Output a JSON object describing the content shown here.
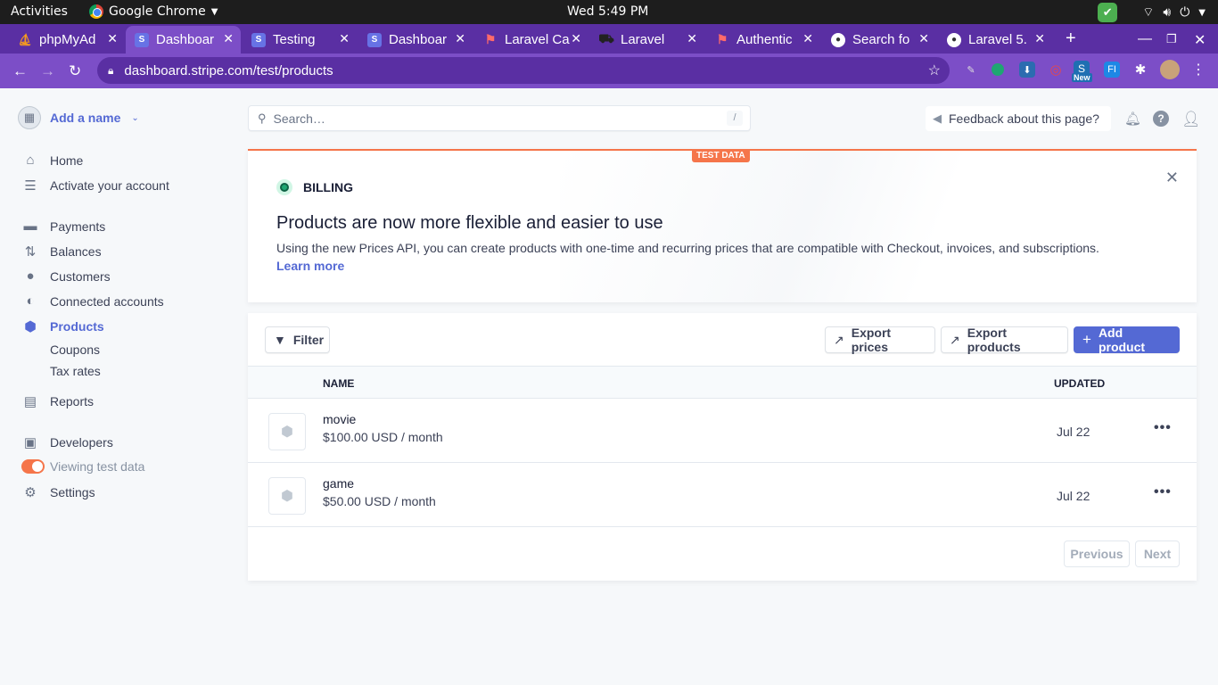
{
  "os": {
    "activities": "Activities",
    "app_name": "Google Chrome",
    "clock": "Wed  5:49 PM"
  },
  "browser": {
    "tabs": [
      {
        "label": "phpMyAd",
        "favicon": "phpmyadmin-icon"
      },
      {
        "label": "Dashboar",
        "favicon": "stripe-icon",
        "active": true
      },
      {
        "label": "Testing",
        "favicon": "stripe-icon"
      },
      {
        "label": "Dashboar",
        "favicon": "stripe-icon"
      },
      {
        "label": "Laravel Ca",
        "favicon": "laravel-icon"
      },
      {
        "label": "Laravel",
        "favicon": "truck-icon"
      },
      {
        "label": "Authentic",
        "favicon": "laravel-icon"
      },
      {
        "label": "Search fo",
        "favicon": "github-icon"
      },
      {
        "label": "Laravel 5.",
        "favicon": "github-icon"
      }
    ],
    "url": "dashboard.stripe.com/test/products",
    "ext_new_badge": "New",
    "ext_fi_label": "FI"
  },
  "sidebar": {
    "account_name": "Add a name",
    "items": [
      {
        "label": "Home",
        "icon": "home-icon"
      },
      {
        "label": "Activate your account",
        "icon": "list-edit-icon"
      },
      {
        "label": "Payments",
        "icon": "wallet-icon"
      },
      {
        "label": "Balances",
        "icon": "arrows-icon"
      },
      {
        "label": "Customers",
        "icon": "user-circle-icon"
      },
      {
        "label": "Connected accounts",
        "icon": "globe-icon"
      },
      {
        "label": "Products",
        "icon": "cube-icon",
        "active": true
      },
      {
        "label": "Reports",
        "icon": "report-icon"
      },
      {
        "label": "Developers",
        "icon": "terminal-icon"
      },
      {
        "label": "Viewing test data",
        "icon": "toggle-icon"
      },
      {
        "label": "Settings",
        "icon": "gear-icon"
      }
    ],
    "subitems": [
      "Coupons",
      "Tax rates"
    ]
  },
  "topbar": {
    "search_placeholder": "Search…",
    "search_shortcut": "/",
    "feedback": "Feedback about this page?"
  },
  "banner": {
    "badge": "TEST DATA",
    "section": "BILLING",
    "title": "Products are now more flexible and easier to use",
    "body": "Using the new Prices API, you can create products with one-time and recurring prices that are compatible with Checkout, invoices, and subscriptions.",
    "link": "Learn more"
  },
  "products": {
    "filter": "Filter",
    "export_prices": "Export prices",
    "export_products": "Export products",
    "add_product": "Add product",
    "columns": {
      "name": "NAME",
      "updated": "UPDATED"
    },
    "rows": [
      {
        "name": "movie",
        "price": "$100.00 USD / month",
        "updated": "Jul 22"
      },
      {
        "name": "game",
        "price": "$50.00 USD / month",
        "updated": "Jul 22"
      }
    ],
    "previous": "Previous",
    "next": "Next"
  },
  "colors": {
    "brand_purple": "#7c4ec7",
    "stripe_accent": "#5469d4",
    "test_orange": "#f5754a"
  }
}
